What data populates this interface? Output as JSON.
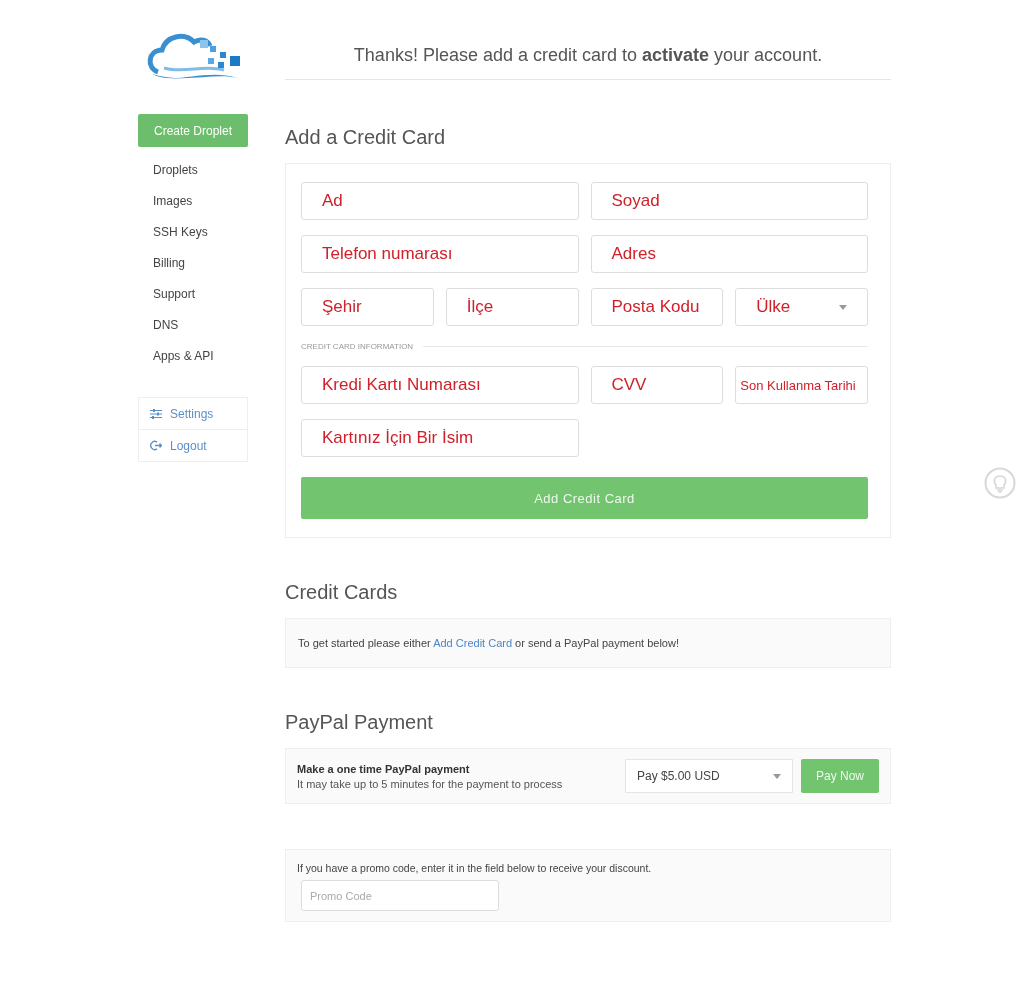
{
  "sidebar": {
    "create_button": "Create Droplet",
    "items": [
      {
        "label": "Droplets"
      },
      {
        "label": "Images"
      },
      {
        "label": "SSH Keys"
      },
      {
        "label": "Billing"
      },
      {
        "label": "Support"
      },
      {
        "label": "DNS"
      },
      {
        "label": "Apps & API"
      }
    ],
    "account_menu": [
      {
        "kind": "settings",
        "label": "Settings"
      },
      {
        "kind": "logout",
        "label": "Logout"
      }
    ]
  },
  "header": {
    "message": "Thanks! Please add a credit card to **activate** your account."
  },
  "add_card": {
    "title": "Add a Credit Card",
    "address_rows": [
      [
        {
          "kind": "text",
          "value": "Ad"
        },
        {
          "kind": "text",
          "value": "Soyad"
        }
      ],
      [
        {
          "kind": "text",
          "value": "Telefon numarası"
        },
        {
          "kind": "text",
          "value": "Adres"
        }
      ],
      [
        {
          "kind": "text",
          "value": "Şehir"
        },
        {
          "kind": "text",
          "value": "İlçe"
        },
        {
          "kind": "text",
          "value": "Posta Kodu"
        },
        {
          "kind": "select",
          "value": "Ülke"
        }
      ]
    ],
    "section_label": "CREDIT CARD INFORMATION",
    "card_rows": [
      [
        {
          "kind": "text",
          "value": "Kredi Kartı Numarası"
        },
        {
          "kind": "text",
          "value": "CVV"
        },
        {
          "kind": "small",
          "value": "Son Kullanma Tarihi"
        }
      ],
      [
        {
          "kind": "text",
          "value": "Kartınız İçin Bir İsim"
        }
      ]
    ],
    "submit": "Add Credit Card"
  },
  "credit_cards": {
    "title": "Credit Cards",
    "text_before": "To get started please either",
    "link": "Add Credit Card",
    "text_after": "or send a PayPal payment below!"
  },
  "paypal": {
    "title": "PayPal Payment",
    "heading": "Make a one time PayPal payment",
    "note": "It may take up to 5 minutes for the payment to process",
    "amount": "Pay $5.00 USD",
    "button": "Pay Now"
  },
  "promo": {
    "text": "If you have a promo code, enter it in the field below to receive your discount.",
    "placeholder": "Promo Code"
  }
}
